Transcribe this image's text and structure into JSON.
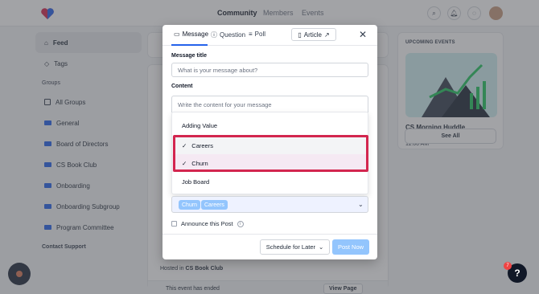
{
  "topnav": {
    "items": [
      "Community",
      "Members",
      "Events"
    ]
  },
  "sidebar": {
    "items": [
      {
        "label": "Feed",
        "icon": "home-icon"
      },
      {
        "label": "Tags",
        "icon": "tag-icon"
      }
    ],
    "groups_heading": "Groups",
    "groups": [
      {
        "label": "All Groups",
        "icon": "grid-icon"
      },
      {
        "label": "General",
        "icon": "group-icon"
      },
      {
        "label": "Board of Directors",
        "icon": "group-icon"
      },
      {
        "label": "CS Book Club",
        "icon": "group-icon"
      },
      {
        "label": "Onboarding",
        "icon": "group-icon"
      },
      {
        "label": "Onboarding Subgroup",
        "icon": "group-icon"
      },
      {
        "label": "Program Committee",
        "icon": "group-icon"
      }
    ],
    "contact": "Contact Support"
  },
  "feed": {
    "hosted_prefix": "Hosted in ",
    "hosted_group": "CS Book Club",
    "ended": "This event has ended",
    "view_page": "View Page"
  },
  "upcoming": {
    "title": "UPCOMING EVENTS",
    "event_name": "CS Morning Huddle",
    "event_date": "Jun 15, 2021 4:00 PM - Jul 23, 2024 11:00 AM",
    "see_all": "See All"
  },
  "modal": {
    "tabs": {
      "message": "Message",
      "question": "Question",
      "poll": "Poll",
      "article": "Article"
    },
    "title_label": "Message title",
    "title_placeholder": "What is your message about?",
    "content_label": "Content",
    "content_placeholder": "Write the content for your message",
    "options": [
      {
        "label": "Adding Value",
        "checked": false
      },
      {
        "label": "Careers",
        "checked": true
      },
      {
        "label": "Churn",
        "checked": true
      },
      {
        "label": "Job Board",
        "checked": false
      }
    ],
    "selected_tags": [
      "Churn",
      "Careers"
    ],
    "announce_label": "Announce this Post",
    "schedule_label": "Schedule for Later",
    "post_label": "Post Now"
  },
  "help": {
    "badge": "7",
    "label": "?"
  },
  "colors": {
    "accent": "#2563eb",
    "highlight": "#d3264f",
    "chip": "#93c5fd"
  }
}
